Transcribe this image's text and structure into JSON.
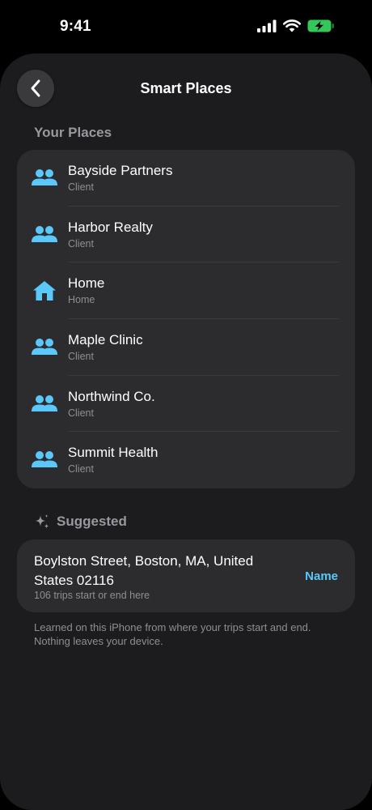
{
  "status_bar": {
    "time": "9:41",
    "signal_icon": "cellular-signal-icon",
    "wifi_icon": "wifi-icon",
    "battery_icon": "battery-charging-icon",
    "battery_color": "#34c759"
  },
  "nav": {
    "back_icon": "chevron-left-icon",
    "title": "Smart Places"
  },
  "your_places": {
    "header": "Your Places",
    "items": [
      {
        "name": "Bayside Partners",
        "category": "Client",
        "icon": "people-icon"
      },
      {
        "name": "Harbor Realty",
        "category": "Client",
        "icon": "people-icon"
      },
      {
        "name": "Home",
        "category": "Home",
        "icon": "house-icon"
      },
      {
        "name": "Maple Clinic",
        "category": "Client",
        "icon": "people-icon"
      },
      {
        "name": "Northwind Co.",
        "category": "Client",
        "icon": "people-icon"
      },
      {
        "name": "Summit Health",
        "category": "Client",
        "icon": "people-icon"
      }
    ]
  },
  "suggested": {
    "header": "Suggested",
    "icon": "sparkles-icon",
    "item": {
      "address": "Boylston Street, Boston, MA, United States 02116",
      "detail": "106 trips start or end here",
      "action_label": "Name"
    }
  },
  "footnote": "Learned on this iPhone from where your trips start and end. Nothing leaves your device.",
  "colors": {
    "accent": "#5ac8fa",
    "icon_blue": "#5ac8fa",
    "sheet_background": "#1c1c1e",
    "card_background": "#2c2c2e"
  }
}
